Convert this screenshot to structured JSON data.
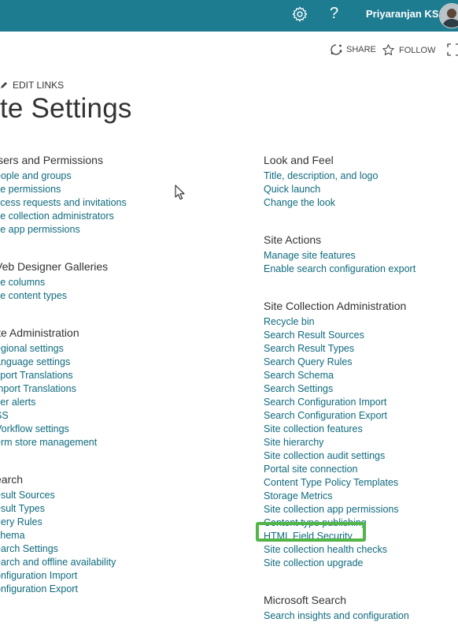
{
  "suitebar": {
    "user_name": "Priyaranjan KS",
    "help_glyph": "?",
    "accent": "#1e7c91"
  },
  "actionbar": {
    "share": "SHARE",
    "follow": "FOLLOW"
  },
  "edit_links": "EDIT LINKS",
  "title": "ite Settings",
  "left_column": [
    {
      "heading": "lsers and Permissions",
      "links": [
        "eople and groups",
        "ite permissions",
        "ccess requests and invitations",
        "ite collection administrators",
        "ite app permissions"
      ]
    },
    {
      "heading": "Veb Designer Galleries",
      "links": [
        "ite columns",
        "ite content types"
      ]
    },
    {
      "heading": "ite Administration",
      "links": [
        "egional settings",
        "anguage settings",
        "xport Translations",
        "mport Translations",
        "ser alerts",
        "SS",
        "Vorkflow settings",
        "erm store management"
      ]
    },
    {
      "heading": "earch",
      "links": [
        "esult Sources",
        "esult Types",
        "uery Rules",
        "chema",
        "earch Settings",
        "earch and offline availability",
        "onfiguration Import",
        "onfiguration Export"
      ]
    }
  ],
  "right_column": [
    {
      "heading": "Look and Feel",
      "links": [
        "Title, description, and logo",
        "Quick launch",
        "Change the look"
      ]
    },
    {
      "heading": "Site Actions",
      "links": [
        "Manage site features",
        "Enable search configuration export"
      ]
    },
    {
      "heading": "Site Collection Administration",
      "links": [
        "Recycle bin",
        "Search Result Sources",
        "Search Result Types",
        "Search Query Rules",
        "Search Schema",
        "Search Settings",
        "Search Configuration Import",
        "Search Configuration Export",
        "Site collection features",
        "Site hierarchy",
        "Site collection audit settings",
        "Portal site connection",
        "Content Type Policy Templates",
        "Storage Metrics",
        "Site collection app permissions",
        "Content type publishing",
        "HTML Field Security",
        "Site collection health checks",
        "Site collection upgrade"
      ]
    },
    {
      "heading": "Microsoft Search",
      "links": [
        "Search insights and configuration"
      ]
    }
  ],
  "highlight_color": "#52b548",
  "link_color": "#0f6a7e"
}
